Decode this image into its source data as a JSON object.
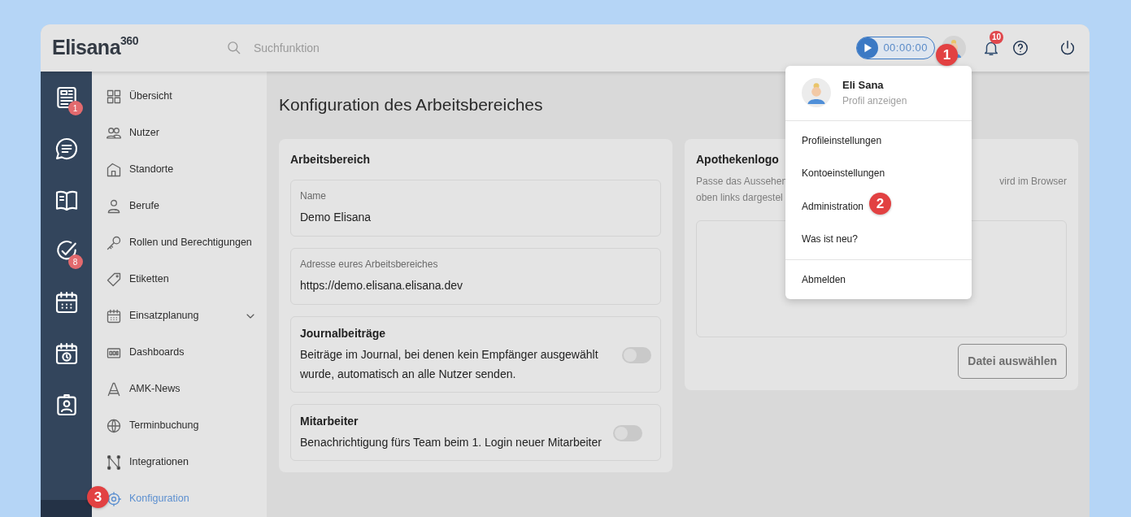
{
  "header": {
    "logo": "Elisana$^{360}$",
    "search": {
      "placeholder": "Suchfunktion"
    },
    "timer": "00:00:00",
    "notifications_badge": "10"
  },
  "rail": {
    "journal_badge": "1",
    "tasks_badge": "8"
  },
  "sidebar": {
    "items": [
      {
        "label": "Übersicht",
        "selected": false
      },
      {
        "label": "Nutzer",
        "selected": false
      },
      {
        "label": "Standorte",
        "selected": false
      },
      {
        "label": "Berufe",
        "selected": false
      },
      {
        "label": "Rollen und Berechtigungen",
        "selected": false
      },
      {
        "label": "Etiketten",
        "selected": false
      },
      {
        "label": "Einsatzplanung",
        "selected": false,
        "expanded": false
      },
      {
        "label": "Dashboards",
        "selected": false
      },
      {
        "label": "AMK-News",
        "selected": false
      },
      {
        "label": "Terminbuchung",
        "selected": false
      },
      {
        "label": "Integrationen",
        "selected": false
      },
      {
        "label": "Konfiguration",
        "selected": true
      }
    ]
  },
  "page_title": "Konfiguration des Arbeitsbereiches",
  "workspace_card": {
    "title": "Arbeitsbereich",
    "fields": [
      {
        "label": "Name",
        "value": "Demo Elisana"
      },
      {
        "label": "Adresse eures Arbeitsbereiches",
        "value": "https://demo.elisana.elisana.dev"
      }
    ],
    "settings": [
      {
        "title": "Journalbeiträge",
        "text": "Beiträge im Journal, bei denen kein Empfänger ausgewählt wurde, automatisch an alle Nutzer senden.",
        "on": false
      },
      {
        "title": "Mitarbeiter",
        "text": "Benachrichtigung fürs Team beim 1. Login neuer Mitarbeiter",
        "on": false
      }
    ]
  },
  "logo_card": {
    "title": "Apothekenlogo",
    "description_left": [
      "Passe das Aussehen",
      "oben links dargestel"
    ],
    "description_right": "vird im Browser",
    "button": "Datei auswählen"
  },
  "user_menu": {
    "name": "Eli Sana",
    "subtitle": "Profil anzeigen",
    "groups": [
      [
        "Profileinstellungen",
        "Kontoeinstellungen",
        "Administration",
        "Was ist neu?"
      ],
      [
        "Abmelden"
      ]
    ]
  },
  "callouts": [
    {
      "number": "1"
    },
    {
      "number": "2"
    },
    {
      "number": "3"
    }
  ]
}
